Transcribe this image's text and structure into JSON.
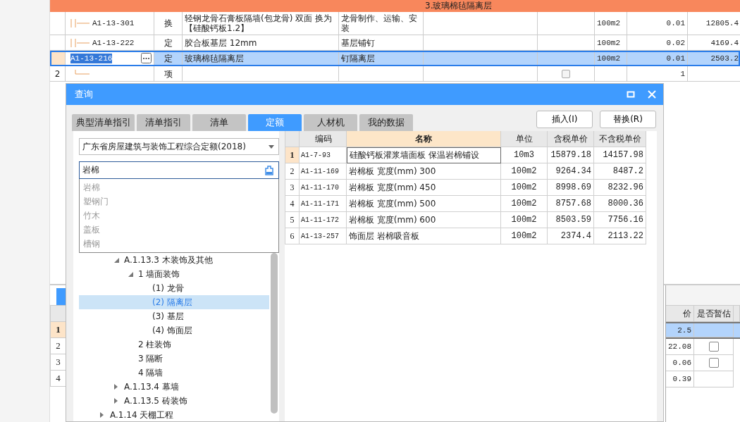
{
  "grid": {
    "group_header": "3.玻璃棉毡隔离层",
    "rows": [
      {
        "kind": "item",
        "code": "A1-13-301",
        "type": "换",
        "name": "轻钢龙骨石膏板隔墙(包龙骨) 双面  换为【硅酸钙板1.2】",
        "content": "龙骨制作、运输、安装",
        "unit": "100m2",
        "qty": "0.01",
        "price": "12805.4",
        "selected": false
      },
      {
        "kind": "item",
        "code": "A1-13-222",
        "type": "定",
        "name": "胶合板基层 12mm",
        "content": "基层铺钉",
        "unit": "100m2",
        "qty": "0.02",
        "price": "4169.4",
        "selected": false
      },
      {
        "kind": "item",
        "code": "A1-13-216",
        "type": "定",
        "name": "玻璃棉毡隔离层",
        "content": "钉隔离层",
        "unit": "100m2",
        "qty": "0.01",
        "price": "2503.2",
        "selected": true
      },
      {
        "kind": "group",
        "number": "2",
        "type": "项",
        "qty": "1",
        "checked": false,
        "selected": false
      }
    ]
  },
  "dialog": {
    "title": "查询",
    "tabs": [
      {
        "label": "典型清单指引",
        "selected": false
      },
      {
        "label": "清单指引",
        "selected": false
      },
      {
        "label": "清单",
        "selected": false
      },
      {
        "label": "定额",
        "selected": true
      },
      {
        "label": "人材机",
        "selected": false
      },
      {
        "label": "我的数据",
        "selected": false
      }
    ],
    "buttons": [
      "插入(I)",
      "替换(R)"
    ],
    "library": {
      "value": "广东省房屋建筑与装饰工程综合定额(2018)"
    },
    "search": {
      "value": "岩棉",
      "suggestions": [
        "岩棉",
        "塑钢门",
        "竹木",
        "盖板",
        "槽钢"
      ]
    },
    "tree": {
      "continued_children": [
        {
          "label": "A.1.13.3 木装饰及其他",
          "expanded": true,
          "selected": false,
          "children": [
            {
              "label": "1 墙面装饰",
              "expanded": true,
              "selected": false,
              "children": [
                {
                  "label": "(1) 龙骨",
                  "selected": false
                },
                {
                  "label": "(2) 隔离层",
                  "selected": true
                },
                {
                  "label": "(3) 基层",
                  "selected": false
                },
                {
                  "label": "(4) 饰面层",
                  "selected": false
                }
              ]
            },
            {
              "label": "2 柱装饰",
              "selected": false
            },
            {
              "label": "3 隔断",
              "selected": false
            },
            {
              "label": "4 隔墙",
              "selected": false
            }
          ]
        },
        {
          "label": "A.1.13.4 幕墙",
          "expanded": false,
          "selected": false
        },
        {
          "label": "A.1.13.5 砖装饰",
          "expanded": false,
          "selected": false
        }
      ],
      "nodes": [
        {
          "label": "A.1.14 天棚工程",
          "expanded": false,
          "selected": false
        }
      ]
    },
    "table": {
      "columns": [
        {
          "label": "编码",
          "highlighted": false
        },
        {
          "label": "名称",
          "highlighted": true
        },
        {
          "label": "单位",
          "highlighted": false
        },
        {
          "label": "含税单价",
          "highlighted": false
        },
        {
          "label": "不含税单价",
          "highlighted": false
        }
      ],
      "rows": [
        {
          "number": "1",
          "code": "A1-7-93",
          "name": "硅酸钙板灌浆墙面板 保温岩棉铺设",
          "unit": "10m3",
          "tax_price": "15879.18",
          "net_price": "14157.98",
          "selected": true
        },
        {
          "number": "2",
          "code": "A1-11-169",
          "name": "岩棉板 宽度(mm) 300",
          "unit": "100m2",
          "tax_price": "9264.34",
          "net_price": "8487.2",
          "selected": false
        },
        {
          "number": "3",
          "code": "A1-11-170",
          "name": "岩棉板 宽度(mm) 450",
          "unit": "100m2",
          "tax_price": "8998.69",
          "net_price": "8232.96",
          "selected": false
        },
        {
          "number": "4",
          "code": "A1-11-171",
          "name": "岩棉板 宽度(mm) 500",
          "unit": "100m2",
          "tax_price": "8757.68",
          "net_price": "8000.36",
          "selected": false
        },
        {
          "number": "5",
          "code": "A1-11-172",
          "name": "岩棉板 宽度(mm) 600",
          "unit": "100m2",
          "tax_price": "8503.59",
          "net_price": "7756.16",
          "selected": false
        },
        {
          "number": "6",
          "code": "A1-13-257",
          "name": "饰面层 岩棉吸音板",
          "unit": "100m2",
          "tax_price": "2374.4",
          "net_price": "2113.22",
          "selected": false
        }
      ]
    }
  },
  "detail": {
    "columns": [
      "价",
      "是否暂估"
    ],
    "rows": [
      {
        "number": "1",
        "total": "2.5",
        "selected": true
      },
      {
        "number": "2",
        "total": "22.08",
        "estimated": false,
        "selected": false
      },
      {
        "number": "3",
        "total": "0.06",
        "estimated": false,
        "selected": false
      },
      {
        "number": "4",
        "total": "0.39",
        "selected": false
      }
    ]
  }
}
